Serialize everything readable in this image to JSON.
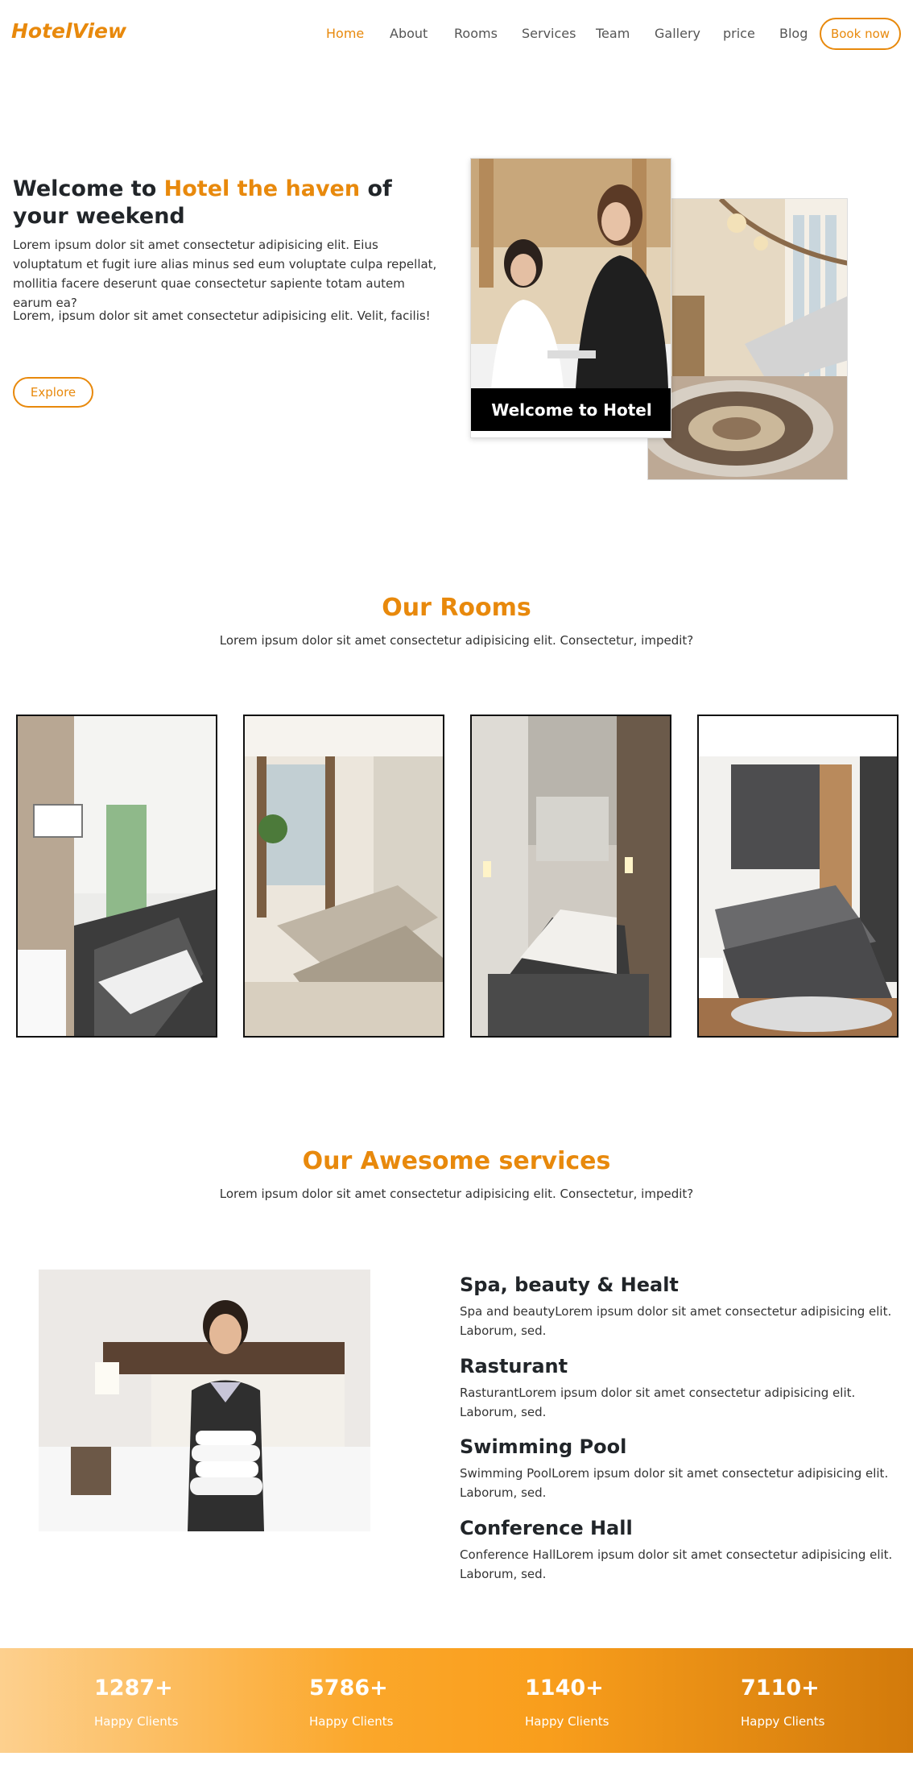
{
  "navbar": {
    "brand": "HotelView",
    "links": [
      "Home",
      "About",
      "Rooms",
      "Services",
      "Team",
      "Gallery",
      "price",
      "Blog"
    ],
    "cta": "Book now"
  },
  "hero": {
    "title_prefix": "Welcome to ",
    "title_highlight": "Hotel the haven",
    "title_suffix": " of your weekend",
    "p1": "Lorem ipsum dolor sit amet consectetur adipisicing elit. Eius voluptatum et fugit iure alias minus sed eum voluptate culpa repellat, mollitia facere deserunt quae consectetur sapiente totam autem earum ea?",
    "p2": "Lorem, ipsum dolor sit amet consectetur adipisicing elit. Velit, facilis!",
    "button": "Explore",
    "image_caption": "Welcome to Hotel"
  },
  "rooms": {
    "title": "Our Rooms",
    "subtitle": "Lorem ipsum dolor sit amet consectetur adipisicing elit. Consectetur, impedit?"
  },
  "services": {
    "title": "Our Awesome services",
    "subtitle": "Lorem ipsum dolor sit amet consectetur adipisicing elit. Consectetur, impedit?",
    "items": [
      {
        "title": "Spa, beauty & Healt",
        "text": "Spa and beautyLorem ipsum dolor sit amet consectetur adipisicing elit. Laborum, sed."
      },
      {
        "title": "Rasturant",
        "text": "RasturantLorem ipsum dolor sit amet consectetur adipisicing elit. Laborum, sed."
      },
      {
        "title": "Swimming Pool",
        "text": "Swimming PoolLorem ipsum dolor sit amet consectetur adipisicing elit. Laborum, sed."
      },
      {
        "title": "Conference Hall",
        "text": "Conference HallLorem ipsum dolor sit amet consectetur adipisicing elit. Laborum, sed."
      }
    ]
  },
  "stats": [
    {
      "value": "1287+",
      "label": "Happy Clients"
    },
    {
      "value": "5786+",
      "label": "Happy Clients"
    },
    {
      "value": "1140+",
      "label": "Happy Clients"
    },
    {
      "value": "7110+",
      "label": "Happy Clients"
    }
  ],
  "colors": {
    "accent": "#e8890c",
    "text": "#212529",
    "stats_gradient_start": "#fdd08e",
    "stats_gradient_end": "#d27a0b"
  }
}
